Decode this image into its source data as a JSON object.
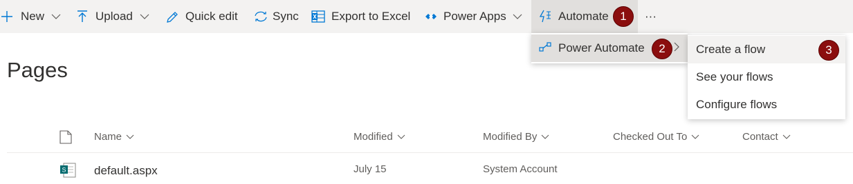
{
  "toolbar": {
    "new_label": "New",
    "upload_label": "Upload",
    "quick_edit_label": "Quick edit",
    "sync_label": "Sync",
    "export_label": "Export to Excel",
    "power_apps_label": "Power Apps",
    "automate_label": "Automate",
    "more_label": "···"
  },
  "annotations": {
    "step1": "1",
    "step2": "2",
    "step3": "3"
  },
  "automate_menu": {
    "power_automate_label": "Power Automate"
  },
  "power_automate_submenu": {
    "items": [
      {
        "label": "Create a flow"
      },
      {
        "label": "See your flows"
      },
      {
        "label": "Configure flows"
      }
    ]
  },
  "page": {
    "title": "Pages"
  },
  "list": {
    "columns": {
      "name": "Name",
      "modified": "Modified",
      "modified_by": "Modified By",
      "checked_out_to": "Checked Out To",
      "contact": "Contact"
    },
    "rows": [
      {
        "name": "default.aspx",
        "modified": "July 15",
        "modified_by": "System Account",
        "icon": "sharepoint-page-icon"
      }
    ]
  },
  "colors": {
    "accent": "#0078d4",
    "badge": "#8b0e0e",
    "command_bar": "#f3f2f1"
  }
}
